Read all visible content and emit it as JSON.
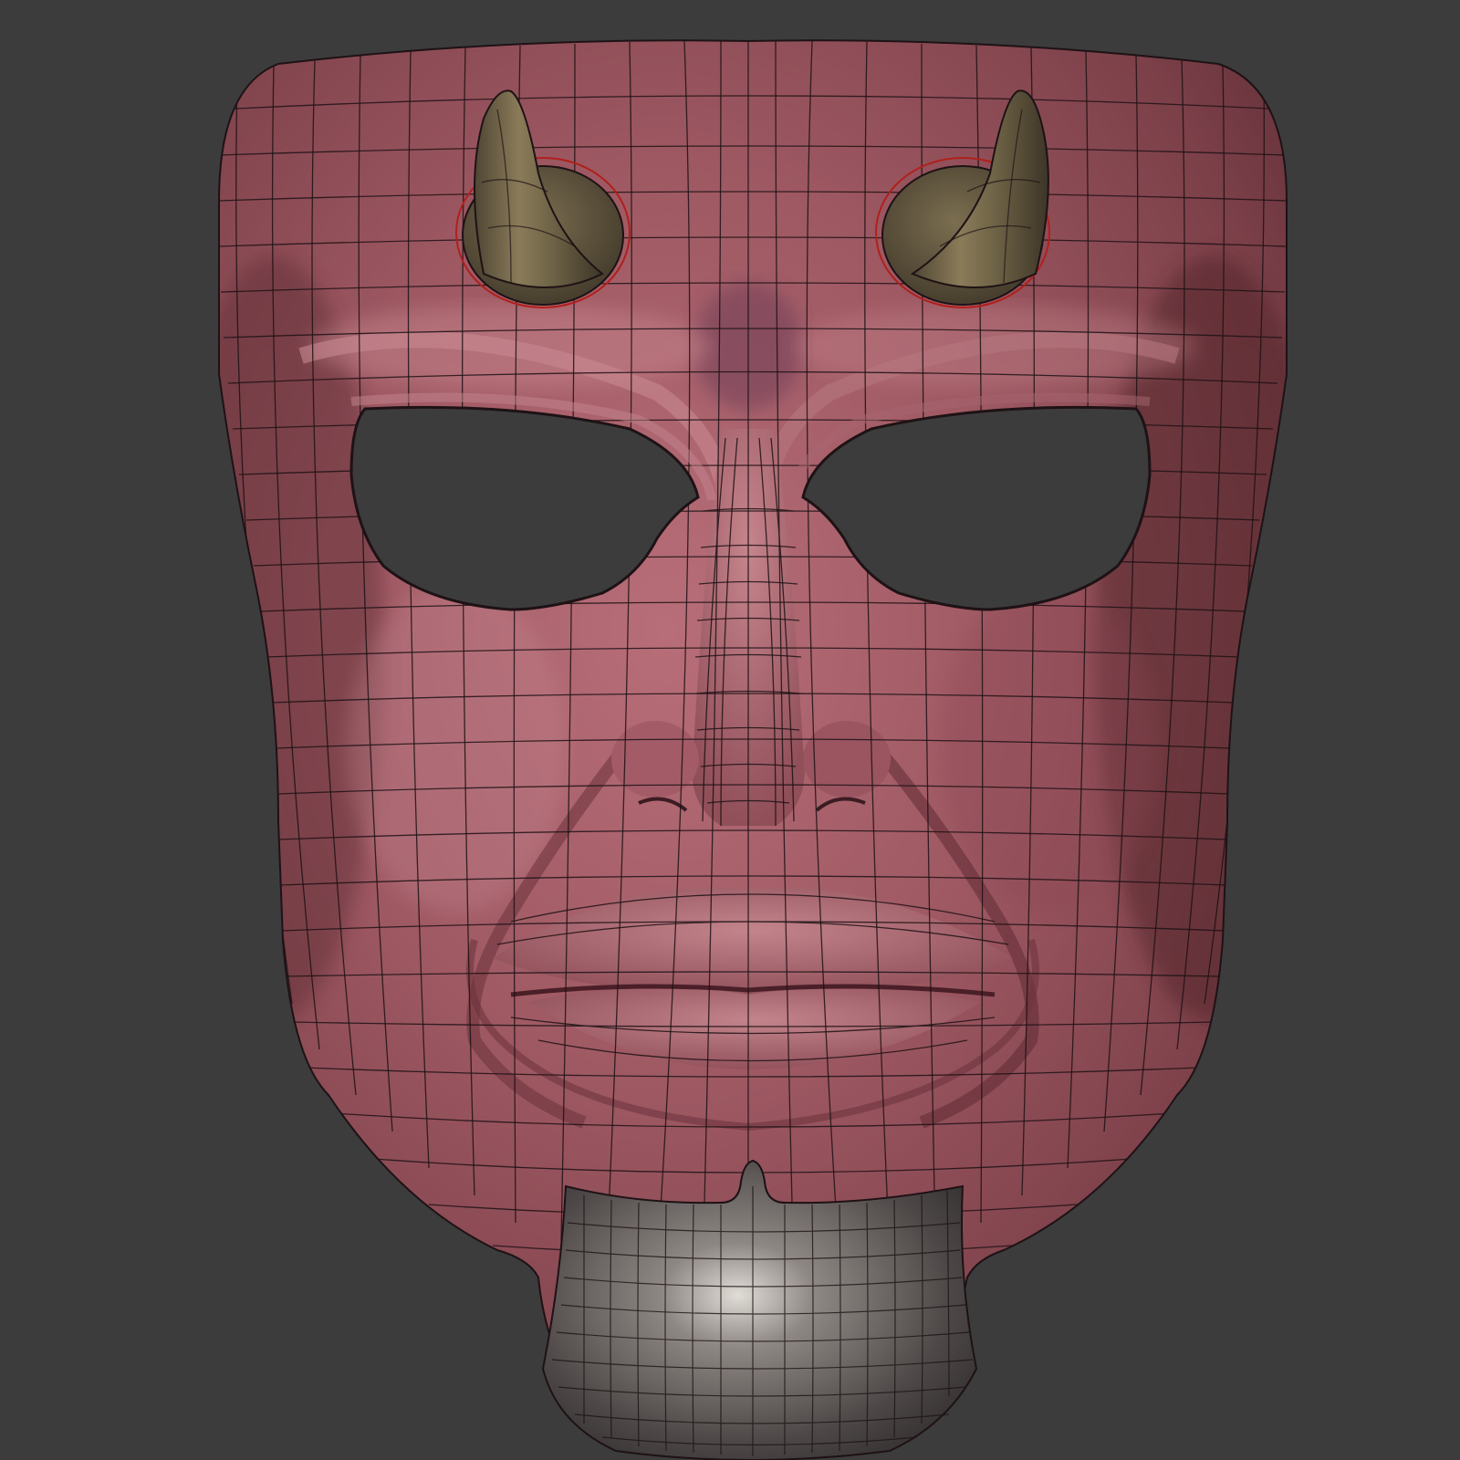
{
  "viewport": {
    "background_color": "#3c3c3c"
  },
  "model": {
    "subject": "devil-mask",
    "display_mode": "wireframe-on-shaded",
    "parts": [
      {
        "name": "face-shell",
        "color": "#9b5560"
      },
      {
        "name": "left-horn",
        "color": "#6e6247"
      },
      {
        "name": "right-horn",
        "color": "#6e6247"
      },
      {
        "name": "chin-guard",
        "color": "#5a5553"
      }
    ],
    "wire_color": "#1e1215",
    "horn_base_outline_color": "#b0201c"
  }
}
